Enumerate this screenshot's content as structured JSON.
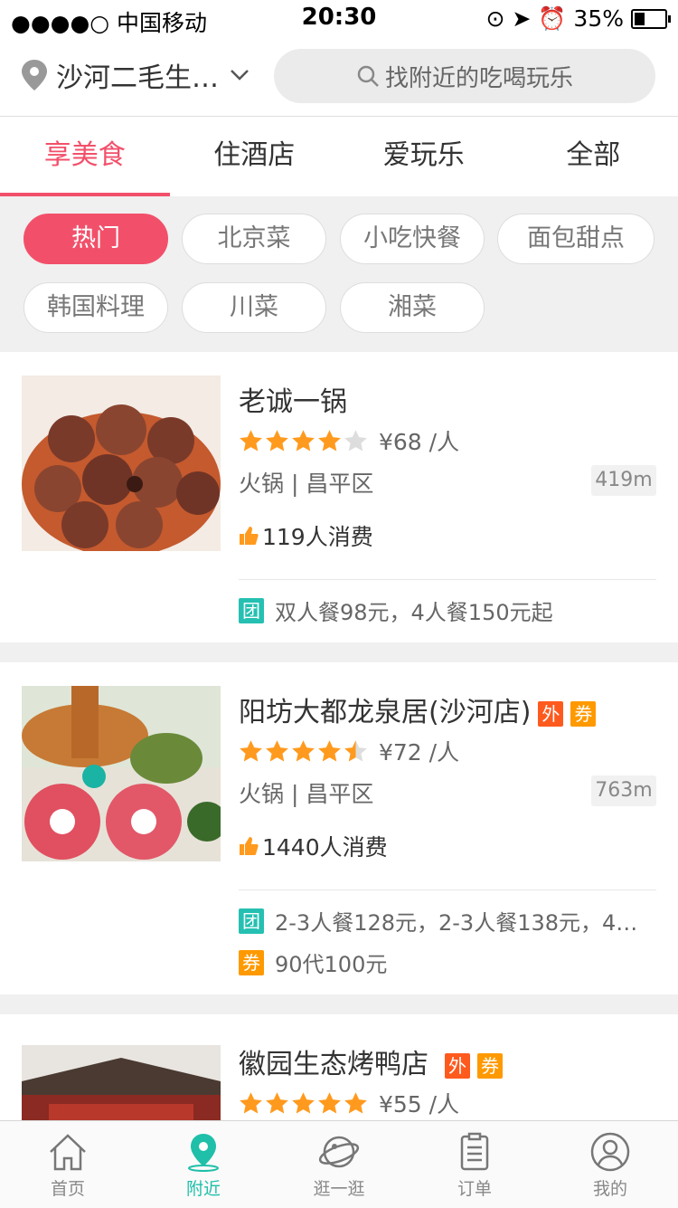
{
  "status": {
    "carrier": "●●●●○ 中国移动",
    "time": "20:30",
    "battery": "35%"
  },
  "header": {
    "location": "沙河二毛生…",
    "search_placeholder": "找附近的吃喝玩乐"
  },
  "tabs": [
    {
      "label": "享美食"
    },
    {
      "label": "住酒店"
    },
    {
      "label": "爱玩乐"
    },
    {
      "label": "全部"
    }
  ],
  "chips": [
    {
      "label": "热门"
    },
    {
      "label": "北京菜"
    },
    {
      "label": "小吃快餐"
    },
    {
      "label": "面包甜点"
    },
    {
      "label": "韩国料理"
    },
    {
      "label": "川菜"
    },
    {
      "label": "湘菜"
    }
  ],
  "restaurants": [
    {
      "name": "老诚一锅",
      "rating": 4,
      "price": "¥68 /人",
      "category": "火锅 | 昌平区",
      "distance": "419m",
      "consumers": "119人消费",
      "deals": [
        {
          "badge": "团",
          "text": "双人餐98元，4人餐150元起"
        }
      ]
    },
    {
      "name": "阳坊大都龙泉居(沙河店)",
      "tags": [
        "外",
        "券"
      ],
      "rating": 4.5,
      "price": "¥72 /人",
      "category": "火锅 | 昌平区",
      "distance": "763m",
      "consumers": "1440人消费",
      "deals": [
        {
          "badge": "团",
          "text": "2-3人餐128元，2-3人餐138元，4…"
        },
        {
          "badge": "券",
          "text": "90代100元"
        }
      ]
    },
    {
      "name": "徽园生态烤鸭店",
      "tags": [
        "外",
        "券"
      ],
      "rating": 5,
      "price": "¥55 /人"
    }
  ],
  "bottom_nav": [
    {
      "label": "首页"
    },
    {
      "label": "附近"
    },
    {
      "label": "逛一逛"
    },
    {
      "label": "订单"
    },
    {
      "label": "我的"
    }
  ],
  "colors": {
    "accent": "#f2506a",
    "teal": "#1fbfa9",
    "star": "#ff9a1e"
  }
}
